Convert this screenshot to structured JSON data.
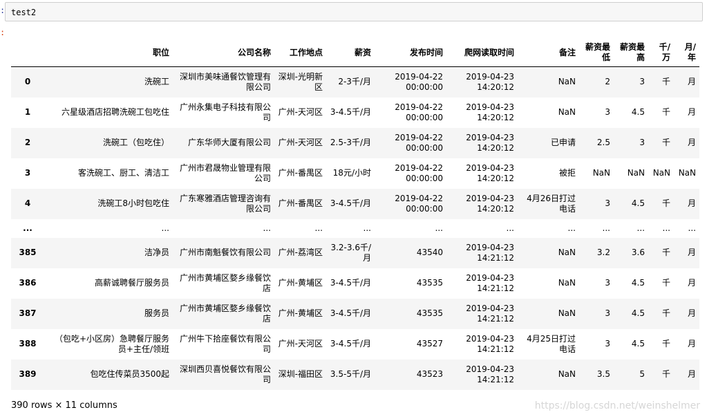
{
  "cell": {
    "in_prompt": ":",
    "out_prompt": ":",
    "code": "test2"
  },
  "table": {
    "columns": [
      "职位",
      "公司名称",
      "工作地点",
      "薪资",
      "发布时间",
      "爬网读取时间",
      "备注",
      "薪资最低",
      "薪资最高",
      "千/万",
      "月/年"
    ],
    "rows": [
      [
        "0",
        "洗碗工",
        "深圳市美味通餐饮管理有限公司",
        "深圳-光明新区",
        "2-3千/月",
        "2019-04-22 00:00:00",
        "2019-04-23 14:20:12",
        "NaN",
        "2",
        "3",
        "千",
        "月"
      ],
      [
        "1",
        "六星级酒店招聘洗碗工包吃住",
        "广州永集电子科技有限公司",
        "广州-天河区",
        "3-4.5千/月",
        "2019-04-22 00:00:00",
        "2019-04-23 14:20:12",
        "NaN",
        "3",
        "4.5",
        "千",
        "月"
      ],
      [
        "2",
        "洗碗工（包吃住）",
        "广东华师大厦有限公司",
        "广州-天河区",
        "2.5-3千/月",
        "2019-04-22 00:00:00",
        "2019-04-23 14:20:12",
        "已申请",
        "2.5",
        "3",
        "千",
        "月"
      ],
      [
        "3",
        "客洗碗工、厨工、清洁工",
        "广州市君晟物业管理有限公司",
        "广州-番禺区",
        "18元/小时",
        "2019-04-22 00:00:00",
        "2019-04-23 14:20:12",
        "被拒",
        "NaN",
        "NaN",
        "NaN",
        "NaN"
      ],
      [
        "4",
        "洗碗工8小时包吃住",
        "广东寒雅酒店管理咨询有限公司",
        "广州-番禺区",
        "3-4.5千/月",
        "2019-04-22 00:00:00",
        "2019-04-23 14:20:12",
        "4月26日打过电话",
        "3",
        "4.5",
        "千",
        "月"
      ],
      [
        "...",
        "...",
        "...",
        "...",
        "...",
        "...",
        "...",
        "...",
        "...",
        "...",
        "...",
        "..."
      ],
      [
        "385",
        "洁净员",
        "广州市南魁餐饮有限公司",
        "广州-荔湾区",
        "3.2-3.6千/月",
        "43540",
        "2019-04-23 14:21:12",
        "NaN",
        "3.2",
        "3.6",
        "千",
        "月"
      ],
      [
        "386",
        "高薪诚聘餐厅服务员",
        "广州市黄埔区婺乡缘餐饮店",
        "广州-黄埔区",
        "3-4.5千/月",
        "43535",
        "2019-04-23 14:21:12",
        "NaN",
        "3",
        "4.5",
        "千",
        "月"
      ],
      [
        "387",
        "服务员",
        "广州市黄埔区婺乡缘餐饮店",
        "广州-黄埔区",
        "3-4.5千/月",
        "43535",
        "2019-04-23 14:21:12",
        "NaN",
        "3",
        "4.5",
        "千",
        "月"
      ],
      [
        "388",
        "（包吃+小区房）急聘餐厅服务员+主任/领班",
        "广州牛下拾座餐饮有限公司",
        "广州-天河区",
        "3-4.5千/月",
        "43527",
        "2019-04-23 14:21:12",
        "4月25日打过电话",
        "3",
        "4.5",
        "千",
        "月"
      ],
      [
        "389",
        "包吃住传菜员3500起",
        "深圳西贝喜悦餐饮有限公司",
        "深圳-福田区",
        "3.5-5千/月",
        "43523",
        "2019-04-23 14:21:12",
        "NaN",
        "3.5",
        "5",
        "千",
        "月"
      ]
    ]
  },
  "footer": "390 rows × 11 columns",
  "watermark": "https://blog.csdn.net/weinshelmer"
}
